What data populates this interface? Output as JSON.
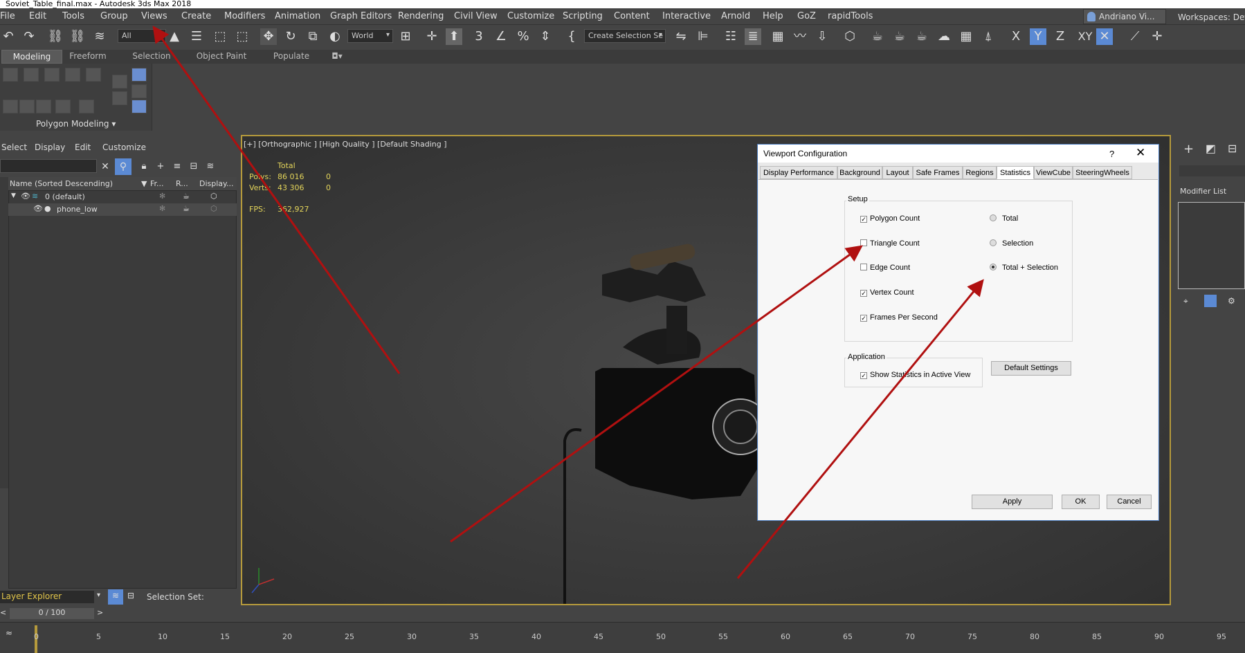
{
  "window": {
    "title": "Soviet_Table_final.max - Autodesk 3ds Max 2018"
  },
  "menu": [
    "File",
    "Edit",
    "Tools",
    "Group",
    "Views",
    "Create",
    "Modifiers",
    "Animation",
    "Graph Editors",
    "Rendering",
    "Civil View",
    "Customize",
    "Scripting",
    "Content",
    "Interactive",
    "Arnold",
    "Help",
    "GoZ",
    "rapidTools"
  ],
  "user": {
    "name": "Andriano Vi...",
    "workspaces_label": "Workspaces: Defa"
  },
  "toolbar": {
    "filter": "All",
    "coordinate": "World",
    "selection_set": "Create Selection Se",
    "axis_x": "X",
    "axis_y": "Y",
    "axis_z": "Z",
    "axis_xy": "XY"
  },
  "ribbon": {
    "tabs": [
      "Modeling",
      "Freeform",
      "Selection",
      "Object Paint",
      "Populate"
    ],
    "panel_label": "Polygon Modeling"
  },
  "scene_explorer": {
    "menu": [
      "Select",
      "Display",
      "Edit",
      "Customize"
    ],
    "columns": [
      "Name (Sorted Descending)",
      "Fr...",
      "R...",
      "Display..."
    ],
    "rows": [
      {
        "name": "0 (default)"
      },
      {
        "name": "phone_low"
      }
    ],
    "explorer_name": "Layer Explorer",
    "selection_set_label": "Selection Set:",
    "frame_counter": "0 / 100"
  },
  "viewport": {
    "label": "[+] [Orthographic ] [High Quality ] [Default Shading ]",
    "stats": {
      "total_header": "Total",
      "polys_label": "Polys:",
      "polys_total": "86 016",
      "polys_sel": "0",
      "verts_label": "Verts:",
      "verts_total": "43 306",
      "verts_sel": "0",
      "fps_label": "FPS:",
      "fps_value": "362,927"
    }
  },
  "command_panel": {
    "modifier_list": "Modifier List"
  },
  "timeline": {
    "ticks": [
      "0",
      "5",
      "10",
      "15",
      "20",
      "25",
      "30",
      "35",
      "40",
      "45",
      "50",
      "55",
      "60",
      "65",
      "70",
      "75",
      "80",
      "85",
      "90",
      "95"
    ]
  },
  "dialog": {
    "title": "Viewport Configuration",
    "help": "?",
    "tabs": [
      "Display Performance",
      "Background",
      "Layout",
      "Safe Frames",
      "Regions",
      "Statistics",
      "ViewCube",
      "SteeringWheels"
    ],
    "active_tab": "Statistics",
    "setup_group": "Setup",
    "checkboxes": [
      {
        "label": "Polygon Count",
        "checked": true
      },
      {
        "label": "Triangle Count",
        "checked": false
      },
      {
        "label": "Edge Count",
        "checked": false
      },
      {
        "label": "Vertex Count",
        "checked": true
      },
      {
        "label": "Frames Per Second",
        "checked": true
      }
    ],
    "radios": [
      {
        "label": "Total",
        "selected": false
      },
      {
        "label": "Selection",
        "selected": false
      },
      {
        "label": "Total + Selection",
        "selected": true
      }
    ],
    "application_group": "Application",
    "show_stats": {
      "label": "Show Statistics in Active View",
      "checked": true
    },
    "default_settings": "Default Settings",
    "buttons": {
      "apply": "Apply",
      "ok": "OK",
      "cancel": "Cancel"
    }
  },
  "colors": {
    "annotation_arrow": "#b01010",
    "viewport_border": "#b59a3c",
    "stats_text": "#e3d45a"
  }
}
